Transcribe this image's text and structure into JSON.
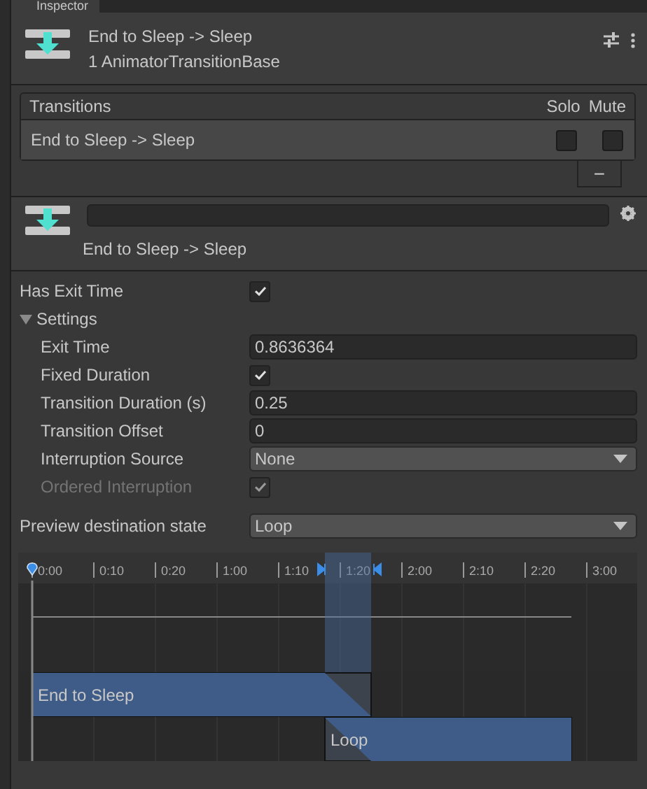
{
  "tab": {
    "label": "Inspector"
  },
  "header": {
    "title": "End to Sleep -> Sleep",
    "subtitle": "1 AnimatorTransitionBase"
  },
  "transitions": {
    "title": "Transitions",
    "columns": [
      "Solo",
      "Mute"
    ],
    "rows": [
      {
        "name": "End to Sleep -> Sleep",
        "solo": false,
        "mute": false
      }
    ],
    "remove_button": "−"
  },
  "transition": {
    "label": "End to Sleep -> Sleep"
  },
  "properties": [
    {
      "kind": "checkbox",
      "label": "Has Exit Time",
      "checked": true,
      "disabled": false
    },
    {
      "kind": "foldout",
      "label": "Settings",
      "expanded": true,
      "children": [
        {
          "kind": "number",
          "label": "Exit Time",
          "value": "0.8636364"
        },
        {
          "kind": "checkbox",
          "label": "Fixed Duration",
          "checked": true,
          "disabled": false
        },
        {
          "kind": "number",
          "label": "Transition Duration (s)",
          "value": "0.25"
        },
        {
          "kind": "number",
          "label": "Transition Offset",
          "value": "0"
        },
        {
          "kind": "dropdown",
          "label": "Interruption Source",
          "value": "None"
        },
        {
          "kind": "checkbox",
          "label": "Ordered Interruption",
          "checked": true,
          "disabled": true
        }
      ]
    }
  ],
  "preview": {
    "label": "Preview destination state",
    "value": "Loop"
  },
  "timeline": {
    "ticks": [
      "0:00",
      "0:10",
      "0:20",
      "1:00",
      "1:10",
      "1:20",
      "2:00",
      "2:10",
      "2:20",
      "3:00"
    ],
    "clips": [
      {
        "name": "End to Sleep"
      },
      {
        "name": "Loop"
      }
    ]
  }
}
